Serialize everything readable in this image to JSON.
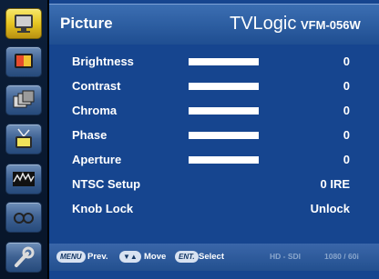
{
  "header": {
    "title": "Picture",
    "brand": "TVLogic",
    "model": "VFM-056W"
  },
  "sidebar": {
    "items": [
      {
        "icon": "monitor-icon",
        "active": true
      },
      {
        "icon": "color-screen-icon",
        "active": false
      },
      {
        "icon": "stacked-screens-icon",
        "active": false
      },
      {
        "icon": "antenna-tv-icon",
        "active": false
      },
      {
        "icon": "scope-waveform-icon",
        "active": false
      },
      {
        "icon": "glasses-icon",
        "active": false
      },
      {
        "icon": "wrench-icon",
        "active": false
      }
    ]
  },
  "settings": [
    {
      "label": "Brightness",
      "value": "0",
      "bar": 1.0
    },
    {
      "label": "Contrast",
      "value": "0",
      "bar": 1.0
    },
    {
      "label": "Chroma",
      "value": "0",
      "bar": 1.0
    },
    {
      "label": "Phase",
      "value": "0",
      "bar": 1.0
    },
    {
      "label": "Aperture",
      "value": "0",
      "bar": 1.0
    },
    {
      "label": "NTSC Setup",
      "value": "0 IRE"
    },
    {
      "label": "Knob Lock",
      "value": "Unlock"
    }
  ],
  "footer": {
    "menu_key": "MENU",
    "menu_label": "Prev.",
    "arrow_key": "▼▲",
    "move_label": "Move",
    "ent_key": "ENT.",
    "select_label": "Select",
    "signal": "HD - SDI",
    "format": "1080 / 60i"
  }
}
